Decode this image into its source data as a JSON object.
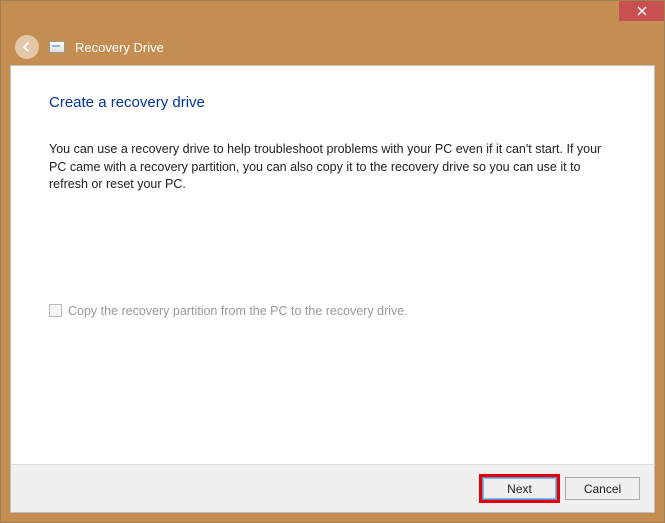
{
  "titlebar": {
    "close_aria": "Close"
  },
  "header": {
    "title": "Recovery Drive"
  },
  "page": {
    "heading": "Create a recovery drive",
    "description": "You can use a recovery drive to help troubleshoot problems with your PC even if it can't start. If your PC came with a recovery partition, you can also copy it to the recovery drive so you can use it to refresh or reset your PC.",
    "checkbox_label": "Copy the recovery partition from the PC to the recovery drive."
  },
  "footer": {
    "next_label": "Next",
    "cancel_label": "Cancel"
  }
}
